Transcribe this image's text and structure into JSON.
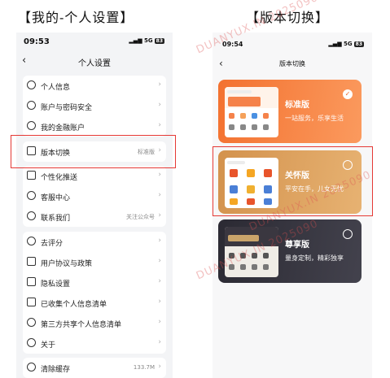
{
  "captions": {
    "left": "【我的-个人设置】",
    "right": "【版本切换】"
  },
  "left_phone": {
    "status": {
      "time": "09:53",
      "signal": "5G",
      "battery": "83"
    },
    "nav": {
      "title": "个人设置"
    },
    "group1": [
      {
        "label": "个人信息",
        "icon": "person-icon"
      },
      {
        "label": "账户与密码安全",
        "icon": "shield-icon"
      },
      {
        "label": "我的金融账户",
        "icon": "finance-icon"
      }
    ],
    "group2": [
      {
        "label": "版本切换",
        "value": "标准版",
        "icon": "version-icon"
      }
    ],
    "group3": [
      {
        "label": "个性化推送",
        "icon": "push-icon"
      },
      {
        "label": "客服中心",
        "icon": "headset-icon"
      },
      {
        "label": "联系我们",
        "value": "关注公众号",
        "icon": "chat-icon"
      }
    ],
    "group4": [
      {
        "label": "去评分",
        "icon": "star-icon"
      },
      {
        "label": "用户协议与政策",
        "icon": "document-icon"
      },
      {
        "label": "隐私设置",
        "icon": "lock-icon"
      },
      {
        "label": "已收集个人信息清单",
        "icon": "list-icon"
      },
      {
        "label": "第三方共享个人信息清单",
        "icon": "share-icon"
      },
      {
        "label": "关于",
        "icon": "info-icon"
      }
    ],
    "group5": [
      {
        "label": "清除缓存",
        "value": "133.7M",
        "icon": "trash-icon"
      }
    ]
  },
  "right_phone": {
    "status": {
      "time": "09:54",
      "signal": "5G",
      "battery": "83"
    },
    "nav": {
      "title": "版本切换"
    },
    "plans": [
      {
        "title": "标准版",
        "subtitle": "一站服务，乐享生活",
        "selected": true,
        "color": "#f3712f",
        "color2": "#fb9a5e"
      },
      {
        "title": "关怀版",
        "subtitle": "平安在手，儿女无忧",
        "selected": false,
        "color": "#d3924d",
        "color2": "#e7b272"
      },
      {
        "title": "尊享版",
        "subtitle": "量身定制，精彩独享",
        "selected": false,
        "color": "#2b2a33",
        "color2": "#43424d"
      }
    ]
  },
  "watermark": "DUANYUX.IN 2025090"
}
